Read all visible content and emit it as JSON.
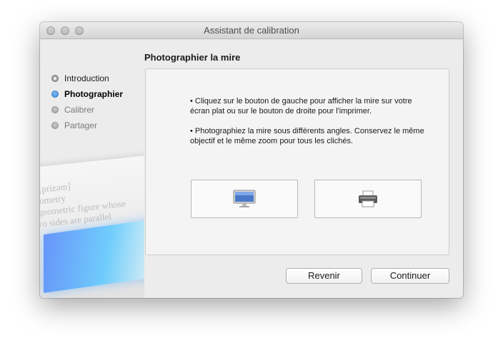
{
  "window": {
    "title": "Assistant de calibration"
  },
  "sidebar": {
    "steps": [
      {
        "label": "Introduction",
        "state": "done"
      },
      {
        "label": "Photographier",
        "state": "active"
      },
      {
        "label": "Calibrer",
        "state": "pending"
      },
      {
        "label": "Partager",
        "state": "pending"
      }
    ]
  },
  "main": {
    "heading": "Photographier la mire",
    "instructions": [
      "• Cliquez sur le bouton de gauche pour afficher la mire sur votre écran plat ou sur le bouton de droite pour l'imprimer.",
      "• Photographiez la mire sous différents angles. Conservez le même objectif et le même zoom pour tous les clichés."
    ],
    "display_button_icon": "desktop-monitor-icon",
    "print_button_icon": "printer-icon"
  },
  "footer": {
    "back_label": "Revenir",
    "continue_label": "Continuer"
  },
  "colors": {
    "accent": "#2d7ed6",
    "window_bg": "#ececec"
  }
}
